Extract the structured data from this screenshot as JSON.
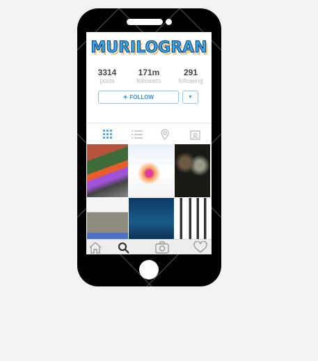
{
  "profile": {
    "username": "MURILOGRAN",
    "stats": [
      {
        "value": "3314",
        "label": "posts"
      },
      {
        "value": "171m",
        "label": "followers"
      },
      {
        "value": "291",
        "label": "following"
      }
    ],
    "follow_label": "FOLLOW",
    "follow_icon": "+",
    "dropdown_icon": "▼"
  },
  "tabs": [
    "grid-icon",
    "list-icon",
    "location-pin-icon",
    "tagged-person-icon"
  ],
  "nav": [
    "home-icon",
    "search-icon",
    "camera-icon",
    "heart-icon"
  ],
  "colors": {
    "accent": "#3b8fd6",
    "phone": "#000000"
  }
}
